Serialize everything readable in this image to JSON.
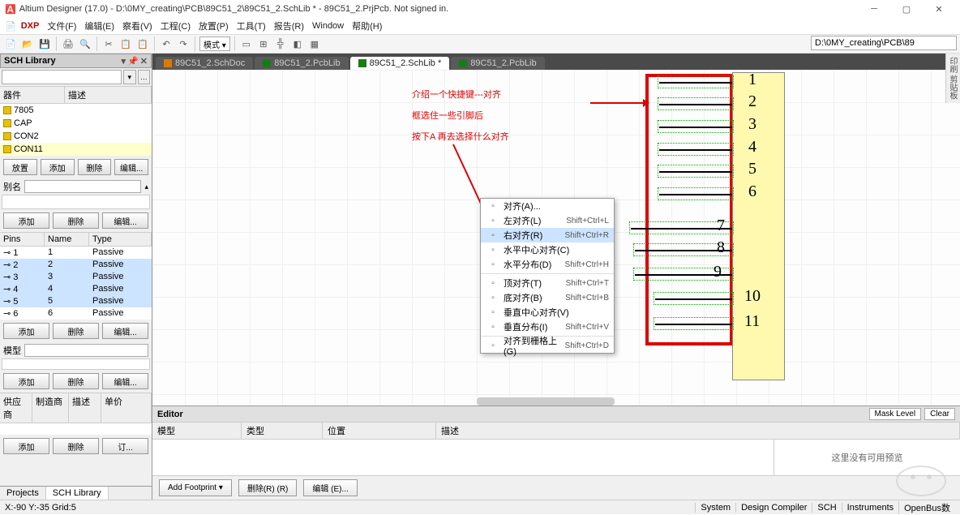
{
  "title": "Altium Designer (17.0) - D:\\0MY_creating\\PCB\\89C51_2\\89C51_2.SchLib * - 89C51_2.PrjPcb. Not signed in.",
  "menubar": {
    "dxp": "DXP",
    "items": [
      "文件(F)",
      "编辑(E)",
      "察看(V)",
      "工程(C)",
      "放置(P)",
      "工具(T)",
      "报告(R)",
      "Window",
      "帮助(H)"
    ]
  },
  "toolbar": {
    "mode_label": "模式 ▾",
    "path": "D:\\0MY_creating\\PCB\\89"
  },
  "panel": {
    "title": "SCH Library"
  },
  "components": {
    "headers": [
      "器件",
      "描述"
    ],
    "items": [
      "7805",
      "CAP",
      "CON2",
      "CON11"
    ],
    "selected": 3,
    "buttons": [
      "放置",
      "添加",
      "删除",
      "编辑..."
    ]
  },
  "alias": {
    "label": "别名",
    "buttons": [
      "添加",
      "删除",
      "编辑..."
    ]
  },
  "pins": {
    "headers": [
      "Pins",
      "Name",
      "Type"
    ],
    "rows": [
      {
        "p": "1",
        "n": "1",
        "t": "Passive"
      },
      {
        "p": "2",
        "n": "2",
        "t": "Passive"
      },
      {
        "p": "3",
        "n": "3",
        "t": "Passive"
      },
      {
        "p": "4",
        "n": "4",
        "t": "Passive"
      },
      {
        "p": "5",
        "n": "5",
        "t": "Passive"
      },
      {
        "p": "6",
        "n": "6",
        "t": "Passive"
      }
    ],
    "selected": [
      1,
      2,
      3,
      4
    ],
    "buttons": [
      "添加",
      "删除",
      "编辑..."
    ]
  },
  "model": {
    "label": "模型",
    "buttons": [
      "添加",
      "删除",
      "编辑..."
    ]
  },
  "supplier": {
    "cols": [
      "供应商",
      "制造商",
      "描述",
      "单价"
    ],
    "buttons": [
      "添加",
      "删除",
      "订..."
    ]
  },
  "bottom_tabs": [
    "Projects",
    "SCH Library"
  ],
  "doctabs": [
    {
      "label": "89C51_2.SchDoc",
      "active": false,
      "color": "#d97b00"
    },
    {
      "label": "89C51_2.PcbLib",
      "active": false,
      "color": "#1a7a1a"
    },
    {
      "label": "89C51_2.SchLib *",
      "active": true,
      "color": "#1a7a1a"
    },
    {
      "label": "89C51_2.PcbLib",
      "active": false,
      "color": "#1a7a1a"
    }
  ],
  "annotation": {
    "line1": "介绍一个快捷键---对齐",
    "line2": "框选住一些引脚后",
    "line3": "按下A  再去选择什么对齐"
  },
  "pin_numbers": [
    "1",
    "2",
    "3",
    "4",
    "5",
    "6",
    "7",
    "8",
    "9",
    "10",
    "11"
  ],
  "context_menu": [
    {
      "label": "对齐(A)...",
      "shortcut": ""
    },
    {
      "label": "左对齐(L)",
      "shortcut": "Shift+Ctrl+L"
    },
    {
      "label": "右对齐(R)",
      "shortcut": "Shift+Ctrl+R",
      "hl": true
    },
    {
      "label": "水平中心对齐(C)",
      "shortcut": ""
    },
    {
      "label": "水平分布(D)",
      "shortcut": "Shift+Ctrl+H"
    },
    {
      "sep": true
    },
    {
      "label": "顶对齐(T)",
      "shortcut": "Shift+Ctrl+T"
    },
    {
      "label": "底对齐(B)",
      "shortcut": "Shift+Ctrl+B"
    },
    {
      "label": "垂直中心对齐(V)",
      "shortcut": ""
    },
    {
      "label": "垂直分布(I)",
      "shortcut": "Shift+Ctrl+V"
    },
    {
      "sep": true
    },
    {
      "label": "对齐到栅格上(G)",
      "shortcut": "Shift+Ctrl+D"
    }
  ],
  "editor": {
    "title": "Editor",
    "btn_mask": "Mask Level",
    "btn_clear": "Clear",
    "cols": [
      "模型",
      "类型",
      "位置",
      "描述"
    ],
    "preview": "这里没有可用预览",
    "footer": [
      "Add Footprint ▾",
      "删除(R) (R)",
      "编辑 (E)..."
    ]
  },
  "status": {
    "left": "X:-90 Y:-35 Grid:5",
    "right": [
      "System",
      "Design Compiler",
      "SCH",
      "Instruments",
      "OpenBus数"
    ]
  },
  "right_strip": "印刷 剪贴板"
}
